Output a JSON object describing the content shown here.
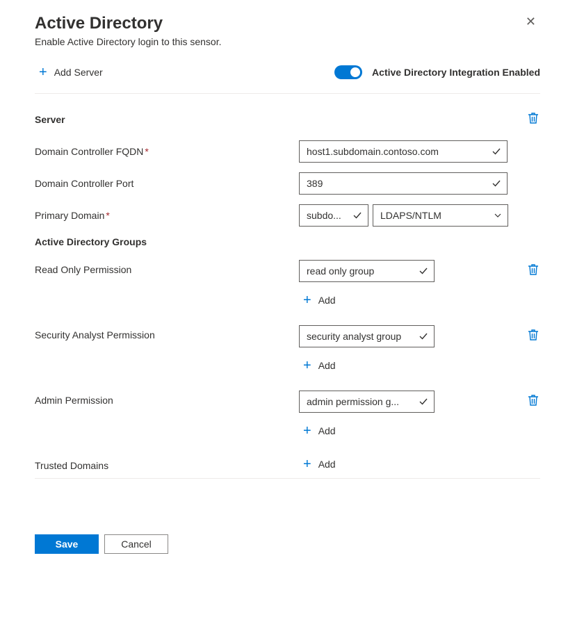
{
  "header": {
    "title": "Active Directory",
    "subtitle": "Enable Active Directory login to this sensor."
  },
  "top": {
    "add_server_label": "Add Server",
    "toggle_label": "Active Directory Integration Enabled",
    "toggle_on": true
  },
  "server": {
    "heading": "Server",
    "fqdn_label": "Domain Controller FQDN",
    "fqdn_value": "host1.subdomain.contoso.com",
    "port_label": "Domain Controller Port",
    "port_value": "389",
    "primary_domain_label": "Primary Domain",
    "primary_domain_value": "subdo...",
    "auth_method_value": "LDAPS/NTLM"
  },
  "groups": {
    "heading": "Active Directory Groups",
    "read_only_label": "Read Only Permission",
    "read_only_value": "read only group",
    "security_analyst_label": "Security Analyst Permission",
    "security_analyst_value": "security analyst group",
    "admin_label": "Admin Permission",
    "admin_value": "admin permission g...",
    "trusted_label": "Trusted Domains",
    "add_label": "Add"
  },
  "footer": {
    "save": "Save",
    "cancel": "Cancel"
  },
  "icons": {
    "plus": "plus-icon",
    "close": "close-icon",
    "trash": "trash-icon",
    "check": "check-icon",
    "chevron_down": "chevron-down-icon"
  }
}
